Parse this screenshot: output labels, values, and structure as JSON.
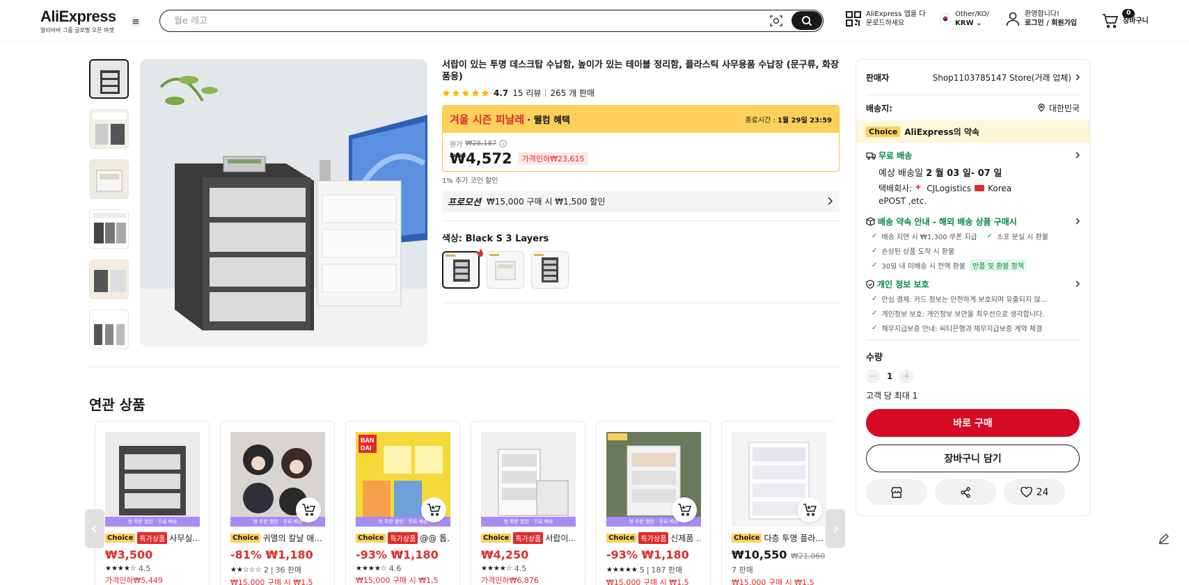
{
  "header": {
    "logo_text": "AliExpress",
    "logo_sub": "알리바바 그룹 글로벌 오픈 마켓",
    "search_placeholder": "월e 레고",
    "app_line1": "AliExpress 앱을 다",
    "app_line2": "운로드하세요",
    "region_line1": "Other/KO/",
    "region_line2": "KRW",
    "account_line1": "환영합니다!",
    "account_line2": "로그인 / 회원가입",
    "cart_count": "0",
    "cart_label": "장바구니"
  },
  "product": {
    "title": "서랍이 있는 투명 데스크탑 수납함, 높이가 있는 테이블 정리함, 플라스틱 사무용품 수납장 (문구류, 화장품용)",
    "rating": "4.7",
    "reviews": "15 리뷰",
    "sold": "265 개 판매",
    "deal_title": "겨울 시즌 피날레",
    "deal_sub": "· 웰컴 혜택",
    "deal_end_label": "종료시간 :",
    "deal_end_time": "1월 29일 23:59",
    "orig_label": "원가",
    "orig_price": "₩28,187",
    "price": "₩4,572",
    "discount": "가격인하₩23,615",
    "coin_note": "1% 추가 코인 할인",
    "promo_label": "프로모션",
    "promo_text": "₩15,000 구매 시 ₩1,500 할인",
    "color_label": "색상: Black S 3 Layers"
  },
  "panel": {
    "seller_label": "판매자",
    "seller_name": "Shop1103785147 Store(거래 업체)",
    "ship_to_label": "배송지:",
    "ship_to": "대한민국",
    "choice_tag": "Choice",
    "choice_text": "AliExpress의 약속",
    "free_ship": "무료 배송",
    "eta_label": "예상 배송일",
    "eta": "2 월 03 일- 07 일",
    "carrier_label": "택배회사:",
    "carrier1": "CJLogistics",
    "carrier2": "Korea",
    "carrier3": "ePOST ,etc.",
    "promise_title": "배송 약속 안내 - 해외 배송 상품 구매시",
    "promise_items": [
      "배송 지연 시 ₩1,300 쿠폰 지급",
      "소포 분실 시 환불",
      "손상된 상품 도착 시 환불",
      "30일 내 미배송 시 전액 환불"
    ],
    "refund_policy": "반품 및 환불 정책",
    "privacy_title": "개인 정보 보호",
    "privacy_items": [
      "안심 결제: 카드 정보는 안전하게 보호되며 유출되지 않...",
      "개인정보 보호: 개인정보 보안을 최우선으로 생각합니다.",
      "채무지급보증 안내: 씨티은행과 채무지급보증 계약 체결"
    ],
    "qty_label": "수량",
    "qty_value": "1",
    "qty_limit": "고객 당 최대 1",
    "buy_now": "바로 구매",
    "add_cart": "장바구니 담기",
    "wish_count": "24"
  },
  "related": {
    "title": "연관 상품",
    "cards": [
      {
        "band": "첫 주문 할인 · 무료 배송",
        "choice": "Choice",
        "special": "특가상품",
        "name": "사무실...",
        "price": "₩3,500",
        "orig": "",
        "rating": "4.5",
        "sold": "",
        "promo": "가격인하₩5,449"
      },
      {
        "band": "첫 주문 할인 · 무료 배송",
        "choice": "Choice",
        "special": "",
        "name": "귀멸의 칼날 애...",
        "price": "-81% ₩1,180",
        "orig": "",
        "rating": "2",
        "sold": "36 판매",
        "promo": "₩15,000 구매 시 ₩1,5"
      },
      {
        "band": "첫 주문 할인 · 무료 배송",
        "choice": "Choice",
        "special": "특가상품",
        "name": "@@ 톱...",
        "price": "-93% ₩1,180",
        "orig": "",
        "rating": "4.6",
        "sold": "",
        "promo": "₩15,000 구매 시 ₩1,5"
      },
      {
        "band": "첫 주문 할인 · 무료 배송",
        "choice": "Choice",
        "special": "특가상품",
        "name": "서랍이...",
        "price": "₩4,250",
        "orig": "",
        "rating": "4.5",
        "sold": "",
        "promo": "가격인하₩6,876"
      },
      {
        "band": "첫 주문 할인 · 무료 배송",
        "choice": "Choice",
        "special": "특가상품",
        "name": "신제품 ...",
        "price": "-93% ₩1,180",
        "orig": "",
        "rating": "5",
        "sold": "187 판매",
        "promo": "₩15,000 구매 시 ₩1,5"
      },
      {
        "band": "",
        "choice": "Choice",
        "special": "",
        "name": "다층 투명 플라...",
        "price": "₩10,550",
        "orig": "₩21,060",
        "rating": "",
        "sold": "7 판매",
        "promo": "₩15,000 구매 시 ₩1,5"
      }
    ]
  },
  "colors": {
    "accent": "#e02b2b",
    "brand_red": "#d60a24",
    "choice_yellow": "#fdd05c",
    "green": "#008a3c"
  }
}
